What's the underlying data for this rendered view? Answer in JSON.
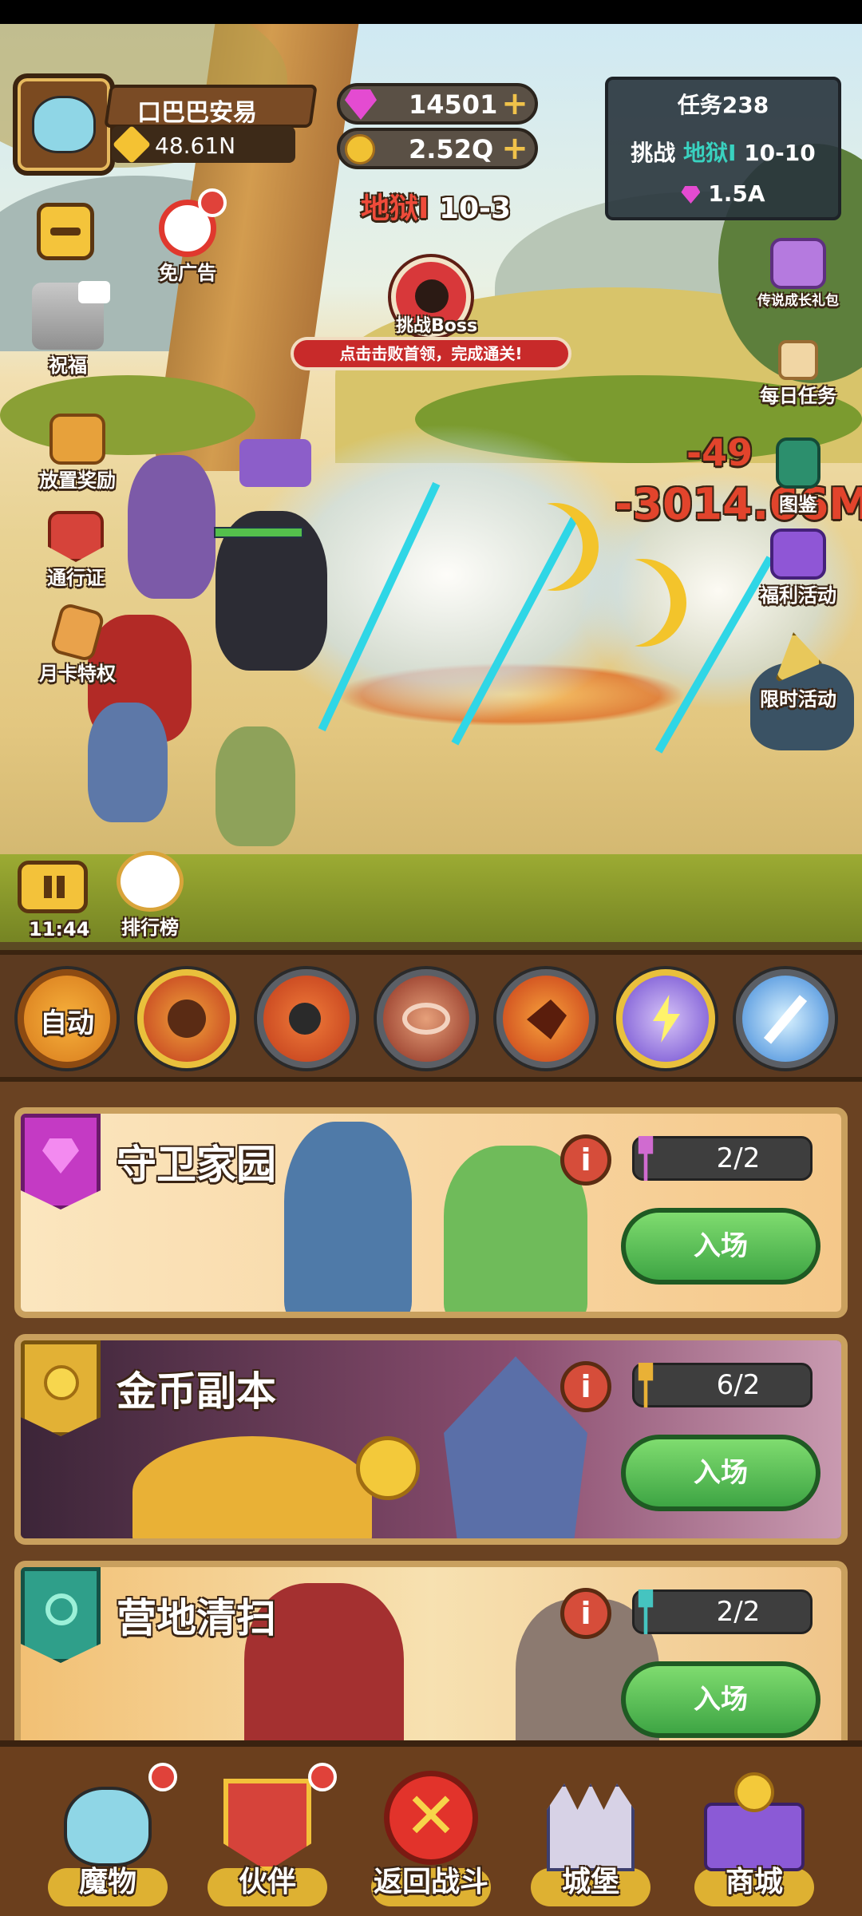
{
  "player": {
    "name": "口巴巴安易",
    "power": "48.61N"
  },
  "currency": {
    "gems": "14501",
    "gold": "2.52Q"
  },
  "stage": {
    "prefix": "地狱I",
    "level": "10-3",
    "boss_label": "挑战Boss",
    "hint": "点击击败首领，完成通关!"
  },
  "quest": {
    "title": "任务238",
    "line_prefix": "挑战",
    "line_highlight": "地狱I",
    "line_suffix": "10-10",
    "reward": "1.5A"
  },
  "left_menu": {
    "no_ads": "免广告",
    "blessing": "祝福",
    "idle_reward": "放置奖励",
    "pass": "通行证",
    "monthly_card": "月卡特权"
  },
  "right_menu": {
    "legend_pack": "传说成长礼包",
    "daily_task": "每日任务",
    "atlas": "图鉴",
    "welfare": "福利活动",
    "limited": "限时活动"
  },
  "damage": {
    "big": "-3014.66M",
    "small": "-49"
  },
  "timer": "11:44",
  "rank_label": "排行榜",
  "auto_label": "自动",
  "dungeons": [
    {
      "title": "守卫家园",
      "count": "2/2",
      "enter": "入场"
    },
    {
      "title": "金币副本",
      "count": "6/2",
      "enter": "入场"
    },
    {
      "title": "营地清扫",
      "count": "2/2",
      "enter": "入场"
    }
  ],
  "nav": {
    "monsters": "魔物",
    "partner": "伙伴",
    "return_battle": "返回战斗",
    "castle": "城堡",
    "shop": "商城"
  },
  "colors": {
    "accent_green": "#3ea544",
    "quest_highlight": "#39d2c0",
    "stage_red": "#d6342a"
  }
}
